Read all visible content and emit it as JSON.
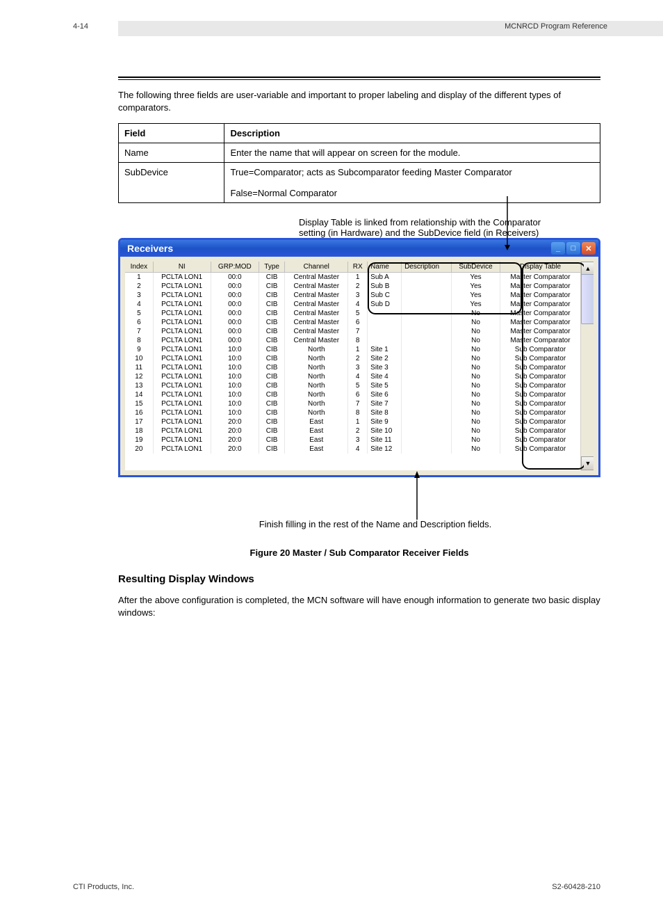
{
  "header": {
    "page_num": "4-14",
    "title": "MCNRCD Program Reference"
  },
  "intro_text": "The following three fields are user-variable and important to proper labeling and display of the different types of comparators.",
  "fields_table": {
    "headers": [
      "Field",
      "Description"
    ],
    "rows": [
      [
        "Name",
        "Enter the name that will appear on screen for the module."
      ],
      [
        "SubDevice",
        "True=Comparator; acts as Subcomparator feeding Master Comparator\n\nFalse=Normal Comparator"
      ]
    ]
  },
  "screenshot": {
    "title": "Receivers",
    "columns": [
      "Index",
      "NI",
      "GRP:MOD",
      "Type",
      "Channel",
      "RX",
      "Name",
      "Description",
      "SubDevice",
      "Display Table"
    ],
    "rows": [
      [
        "1",
        "PCLTA LON1",
        "00:0",
        "CIB",
        "Central Master",
        "1",
        "Sub A",
        "",
        "Yes",
        "Master Comparator"
      ],
      [
        "2",
        "PCLTA LON1",
        "00:0",
        "CIB",
        "Central Master",
        "2",
        "Sub B",
        "",
        "Yes",
        "Master Comparator"
      ],
      [
        "3",
        "PCLTA LON1",
        "00:0",
        "CIB",
        "Central Master",
        "3",
        "Sub C",
        "",
        "Yes",
        "Master Comparator"
      ],
      [
        "4",
        "PCLTA LON1",
        "00:0",
        "CIB",
        "Central Master",
        "4",
        "Sub D",
        "",
        "Yes",
        "Master Comparator"
      ],
      [
        "5",
        "PCLTA LON1",
        "00:0",
        "CIB",
        "Central Master",
        "5",
        "",
        "",
        "No",
        "Master Comparator"
      ],
      [
        "6",
        "PCLTA LON1",
        "00:0",
        "CIB",
        "Central Master",
        "6",
        "",
        "",
        "No",
        "Master Comparator"
      ],
      [
        "7",
        "PCLTA LON1",
        "00:0",
        "CIB",
        "Central Master",
        "7",
        "",
        "",
        "No",
        "Master Comparator"
      ],
      [
        "8",
        "PCLTA LON1",
        "00:0",
        "CIB",
        "Central Master",
        "8",
        "",
        "",
        "No",
        "Master Comparator"
      ],
      [
        "9",
        "PCLTA LON1",
        "10:0",
        "CIB",
        "North",
        "1",
        "Site 1",
        "",
        "No",
        "Sub Comparator"
      ],
      [
        "10",
        "PCLTA LON1",
        "10:0",
        "CIB",
        "North",
        "2",
        "Site 2",
        "",
        "No",
        "Sub Comparator"
      ],
      [
        "11",
        "PCLTA LON1",
        "10:0",
        "CIB",
        "North",
        "3",
        "Site 3",
        "",
        "No",
        "Sub Comparator"
      ],
      [
        "12",
        "PCLTA LON1",
        "10:0",
        "CIB",
        "North",
        "4",
        "Site 4",
        "",
        "No",
        "Sub Comparator"
      ],
      [
        "13",
        "PCLTA LON1",
        "10:0",
        "CIB",
        "North",
        "5",
        "Site 5",
        "",
        "No",
        "Sub Comparator"
      ],
      [
        "14",
        "PCLTA LON1",
        "10:0",
        "CIB",
        "North",
        "6",
        "Site 6",
        "",
        "No",
        "Sub Comparator"
      ],
      [
        "15",
        "PCLTA LON1",
        "10:0",
        "CIB",
        "North",
        "7",
        "Site 7",
        "",
        "No",
        "Sub Comparator"
      ],
      [
        "16",
        "PCLTA LON1",
        "10:0",
        "CIB",
        "North",
        "8",
        "Site 8",
        "",
        "No",
        "Sub Comparator"
      ],
      [
        "17",
        "PCLTA LON1",
        "20:0",
        "CIB",
        "East",
        "1",
        "Site 9",
        "",
        "No",
        "Sub Comparator"
      ],
      [
        "18",
        "PCLTA LON1",
        "20:0",
        "CIB",
        "East",
        "2",
        "Site 10",
        "",
        "No",
        "Sub Comparator"
      ],
      [
        "19",
        "PCLTA LON1",
        "20:0",
        "CIB",
        "East",
        "3",
        "Site 11",
        "",
        "No",
        "Sub Comparator"
      ],
      [
        "20",
        "PCLTA LON1",
        "20:0",
        "CIB",
        "East",
        "4",
        "Site 12",
        "",
        "No",
        "Sub Comparator"
      ]
    ]
  },
  "callouts": {
    "top": "Display Table is linked from relationship with the Comparator setting (in Hardware) and the SubDevice field (in Receivers)",
    "bottom": "Finish filling in the rest of the Name and Description fields."
  },
  "caption": "Figure 20 Master / Sub Comparator Receiver Fields",
  "result": {
    "heading": "Resulting Display Windows",
    "text": "After the above configuration is completed, the MCN software will have enough information to generate two basic display windows:"
  },
  "footer": {
    "copyright": "CTI Products, Inc.",
    "pn": "S2-60428-210"
  }
}
